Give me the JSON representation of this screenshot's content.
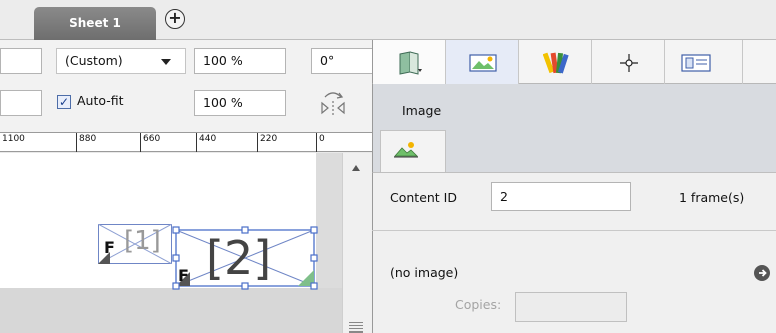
{
  "sheet_tabs": {
    "active_label": "Sheet 1",
    "add_label": "+"
  },
  "toolbar": {
    "zoom_mode": "(Custom)",
    "scale_x": "100 %",
    "scale_y": "100 %",
    "rotation": "0°",
    "autofit_checked": true,
    "autofit_check_glyph": "✓",
    "autofit_label": "Auto-fit",
    "flip_icon": "flip-horizontal-icon"
  },
  "ruler": {
    "ticks": [
      "1100",
      "880",
      "660",
      "440",
      "220",
      "0"
    ]
  },
  "canvas": {
    "frames": [
      {
        "content_id": "[1]",
        "corner_label": "F"
      },
      {
        "content_id": "[2]",
        "corner_label": "F"
      }
    ]
  },
  "panel": {
    "tab_icons": [
      "page-icon",
      "image-icon",
      "color-swatches-icon",
      "crosshair-icon",
      "frame-icon"
    ],
    "title": "Image",
    "subtab_icon": "image-icon",
    "content_id_label": "Content ID",
    "content_id_value": "2",
    "frames_label": "1 frame(s)",
    "no_image_label": "(no image)",
    "copies_label": "Copies:",
    "copies_value": ""
  },
  "colors": {
    "selection": "#4a6fc9",
    "tab_dark": "#7a7a7a",
    "panel_header": "#d8dbe0"
  }
}
